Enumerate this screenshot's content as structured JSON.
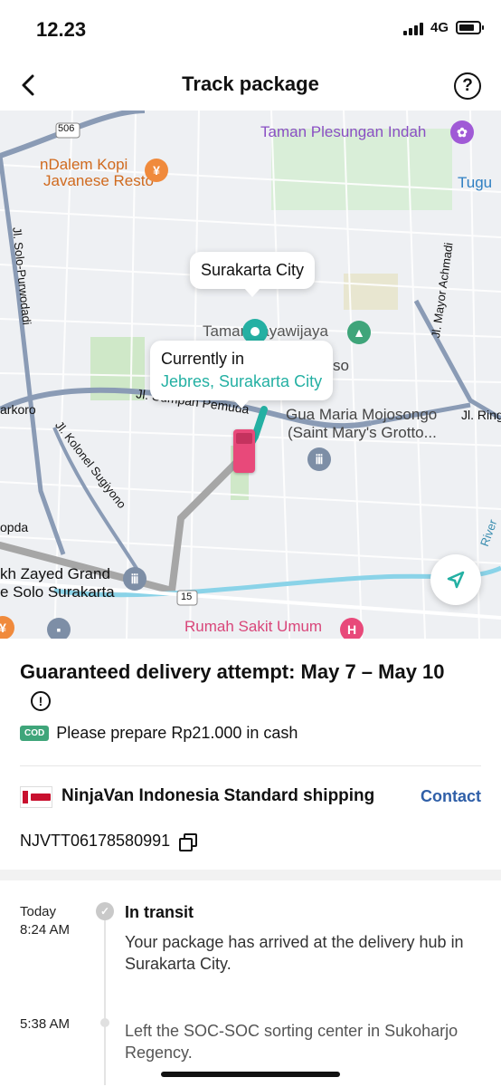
{
  "status_bar": {
    "time": "12.23",
    "network": "4G"
  },
  "header": {
    "title": "Track package",
    "help_glyph": "?"
  },
  "map": {
    "labels": {
      "road_number_top": "506",
      "road_number_bottom": "15",
      "taman_plesungan": "Taman Plesungan Indah",
      "ndalem_kopi_1": "nDalem Kopi",
      "ndalem_kopi_2": "Javanese Resto",
      "tugu": "Tugu",
      "jl_solo_purwodadi": "Jl. Solo-Purwodadi",
      "jl_mayor_achmadi": "Jl. Mayor Achmadi",
      "jl_sumpah_pemuda": "Jl. Sumpah Pemuda",
      "jl_kolonel_sugiyono": "Jl. Kolonel Sugiyono",
      "arkoro": "arkoro",
      "jl_ring": "Jl. Ring",
      "gua_maria_1": "Gua Maria Mojosongo",
      "gua_maria_2": "(Saint Mary's Grotto...",
      "taman_partial": "Taman Jayawijaya",
      "so_partial": "so",
      "rumah_sakit": "Rumah Sakit Umum",
      "sheikh_zayed_1": "kh Zayed Grand",
      "sheikh_zayed_2": "e Solo Surakarta",
      "ropda": "opda",
      "river": "River"
    },
    "city_bubble": "Surakarta City",
    "current_bubble": {
      "line1": "Currently in",
      "line2": "Jebres, Surakarta City"
    }
  },
  "delivery": {
    "guarantee": "Guaranteed delivery attempt: May 7 – May 10",
    "cod_badge": "COD",
    "cod_text": "Please prepare Rp21.000 in cash",
    "carrier_name": "NinjaVan Indonesia Standard shipping",
    "contact_label": "Contact",
    "tracking_number": "NJVTT06178580991"
  },
  "timeline": [
    {
      "date_line1": "Today",
      "date_line2": "8:24 AM",
      "title": "In transit",
      "description": "Your package has arrived at the delivery hub in Surakarta City."
    },
    {
      "date_line1": "5:38 AM",
      "description": "Left the SOC-SOC sorting center in Sukoharjo Regency."
    }
  ],
  "colors": {
    "accent_teal": "#24b0a3",
    "contact_blue": "#2f5fa8",
    "cod_green": "#3fa57a",
    "truck_pink": "#e8497a",
    "hospital_pink": "#e8497a",
    "poi_orange": "#f08a3c",
    "poi_purple": "#a05ad6"
  }
}
